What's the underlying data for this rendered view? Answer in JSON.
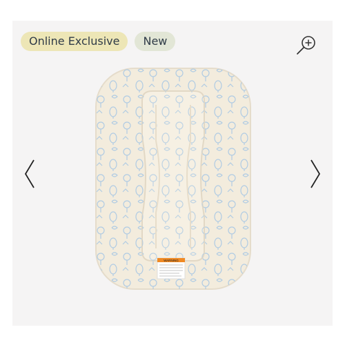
{
  "badges": {
    "online_exclusive": "Online Exclusive",
    "new": "New"
  },
  "icons": {
    "zoom": "zoom-in-icon",
    "prev": "chevron-left-icon",
    "next": "chevron-right-icon"
  },
  "product": {
    "warning_label": "WARNING"
  },
  "colors": {
    "badge_online_bg": "#ede6b6",
    "badge_new_bg": "#e2e6d6",
    "panel_bg": "#f5f4f4",
    "pattern_blue": "#a9c8e4",
    "fabric_cream": "#f3ecdd"
  }
}
